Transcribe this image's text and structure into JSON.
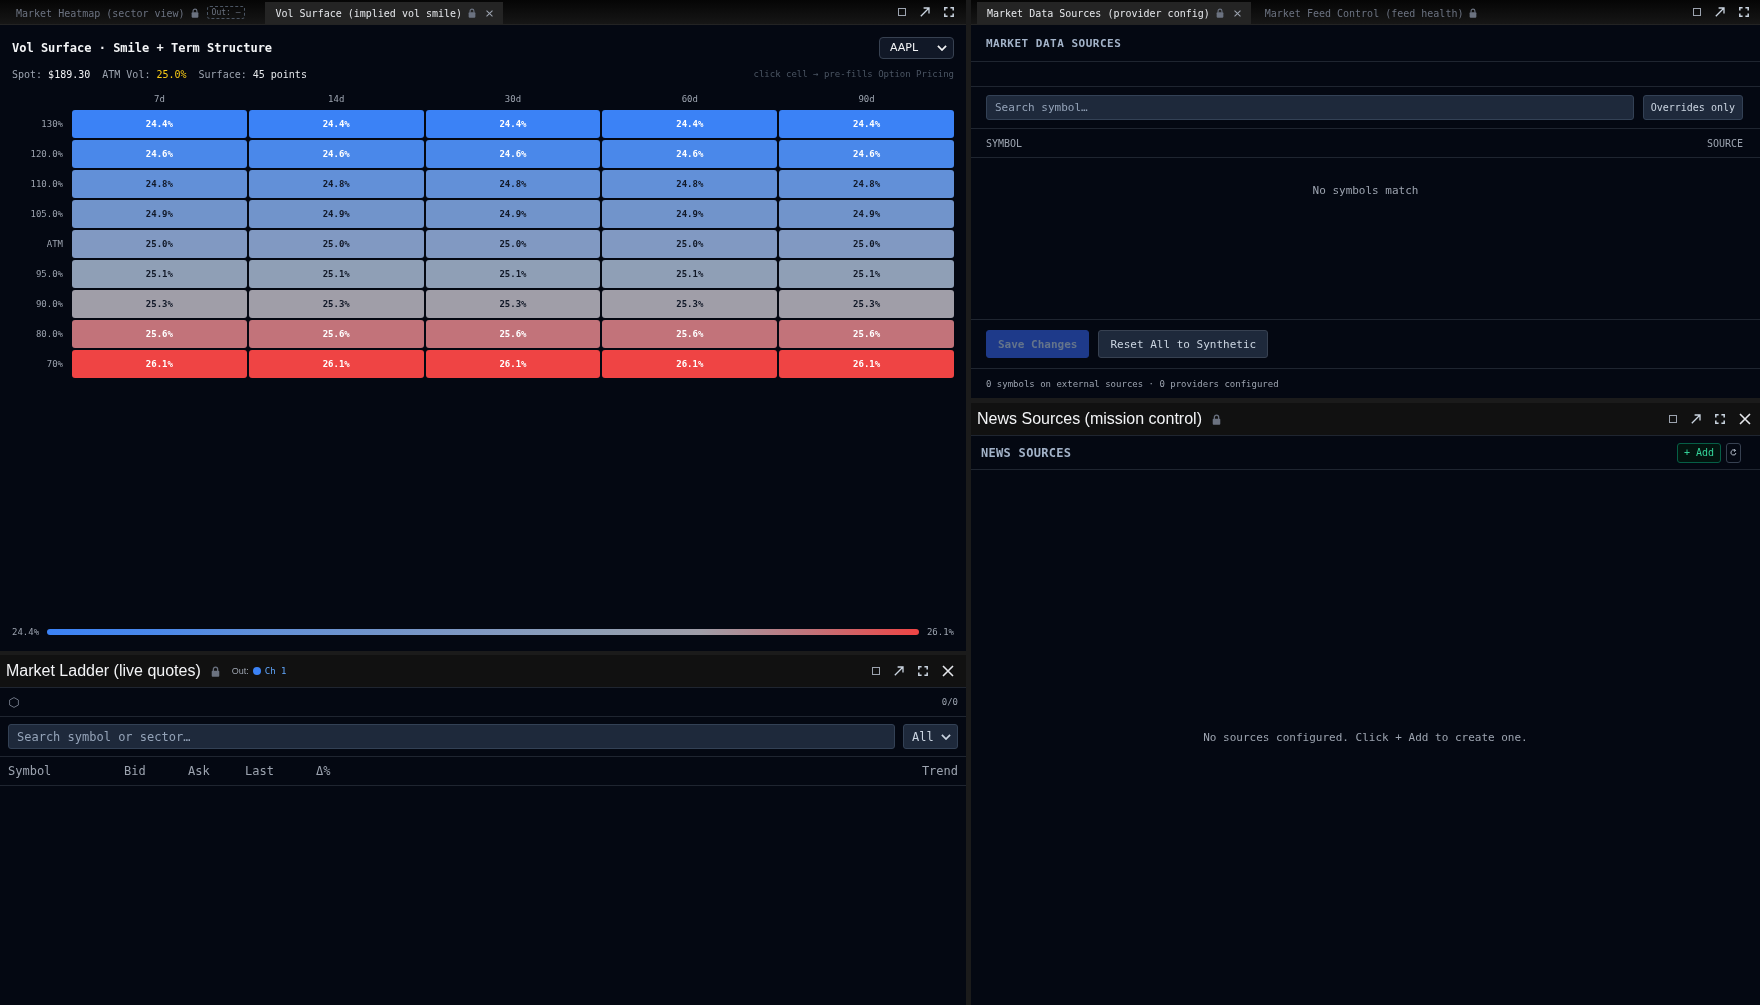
{
  "vol_surface_panel": {
    "tabs": [
      {
        "title": "Market Heatmap (sector view)",
        "selected": false,
        "locked": true,
        "out_badge": "Out: –"
      },
      {
        "title": "Vol Surface (implied vol smile)",
        "selected": true,
        "locked": true
      }
    ],
    "closable": false,
    "title": "Vol Surface · Smile + Term Structure",
    "ticker": "AAPL",
    "stats": [
      {
        "label": "Spot:",
        "value": "$189.30",
        "kind": "price"
      },
      {
        "label": "ATM Vol:",
        "value": "25.0%",
        "kind": "vol"
      },
      {
        "label": "Surface:",
        "value": "45 points",
        "kind": "count"
      }
    ],
    "hint": "click cell → pre-fills Option Pricing",
    "surface": {
      "columns": [
        "7d",
        "14d",
        "30d",
        "60d",
        "90d"
      ],
      "rows": [
        {
          "label": "130%",
          "color": "#3b82f6",
          "cells": [
            "24.4%",
            "24.4%",
            "24.4%",
            "24.4%",
            "24.4%"
          ]
        },
        {
          "label": "120.0%",
          "color": "#4a88ea",
          "cells": [
            "24.6%",
            "24.6%",
            "24.6%",
            "24.6%",
            "24.6%"
          ]
        },
        {
          "label": "110.0%",
          "color": "#6290d8",
          "cells": [
            "24.8%",
            "24.8%",
            "24.8%",
            "24.8%",
            "24.8%"
          ]
        },
        {
          "label": "105.0%",
          "color": "#7194cb",
          "cells": [
            "24.9%",
            "24.9%",
            "24.9%",
            "24.9%",
            "24.9%"
          ]
        },
        {
          "label": "ATM",
          "color": "#8199c2",
          "cells": [
            "25.0%",
            "25.0%",
            "25.0%",
            "25.0%",
            "25.0%"
          ]
        },
        {
          "label": "95.0%",
          "color": "#8f9fb6",
          "cells": [
            "25.1%",
            "25.1%",
            "25.1%",
            "25.1%",
            "25.1%"
          ]
        },
        {
          "label": "90.0%",
          "color": "#a09ea8",
          "cells": [
            "25.3%",
            "25.3%",
            "25.3%",
            "25.3%",
            "25.3%"
          ]
        },
        {
          "label": "80.0%",
          "color": "#c2737a",
          "cells": [
            "25.6%",
            "25.6%",
            "25.6%",
            "25.6%",
            "25.6%"
          ]
        },
        {
          "label": "70%",
          "color": "#ef4444",
          "cells": [
            "26.1%",
            "26.1%",
            "26.1%",
            "26.1%",
            "26.1%"
          ]
        }
      ]
    },
    "legend": {
      "min_label": "24.4%",
      "max_label": "26.1%"
    }
  },
  "market_ladder_panel": {
    "title": "Market Ladder (live quotes)",
    "locked": true,
    "closable": true,
    "output": {
      "label": "Out:",
      "channel": "Ch 1"
    },
    "count": "0/0",
    "search": {
      "placeholder": "Search symbol or sector…"
    },
    "filter": "All",
    "columns": [
      "Symbol",
      "Bid",
      "Ask",
      "Last",
      "Δ%",
      "Trend"
    ]
  },
  "data_sources_panel": {
    "tabs": [
      {
        "title": "Market Data Sources (provider config)",
        "selected": true,
        "locked": true
      },
      {
        "title": "Market Feed Control (feed health)",
        "selected": false,
        "locked": true
      }
    ],
    "closable": false,
    "heading": "MARKET DATA SOURCES",
    "search": {
      "placeholder": "Search symbol…"
    },
    "filter_button": "Overrides only",
    "columns": [
      "SYMBOL",
      "SOURCE"
    ],
    "empty_message": "No symbols match",
    "buttons": [
      {
        "label": "Save Changes",
        "kind": "primary",
        "disabled": true
      },
      {
        "label": "Reset All to Synthetic",
        "kind": "secondary",
        "disabled": false
      }
    ],
    "footer": "0 symbols on external sources · 0 providers configured"
  },
  "news_sources_panel": {
    "title": "News Sources (mission control)",
    "locked": true,
    "closable": true,
    "heading": "NEWS SOURCES",
    "add_button": "+ Add",
    "empty_message": "No sources configured. Click + Add to create one."
  }
}
